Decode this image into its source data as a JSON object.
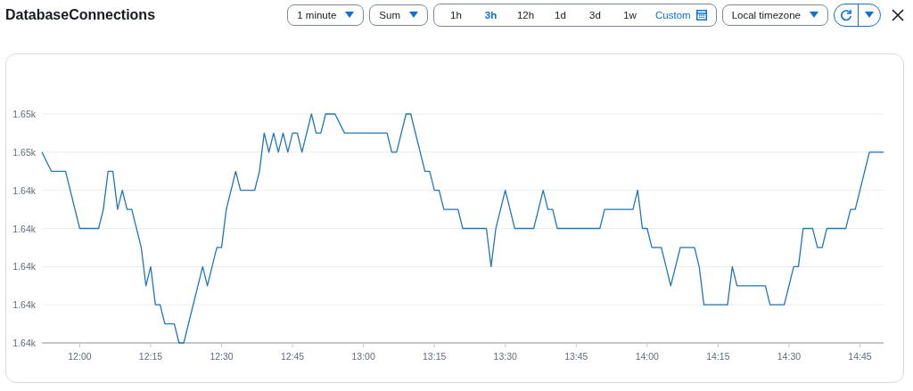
{
  "title": "DatabaseConnections",
  "toolbar": {
    "period": {
      "value": "1 minute"
    },
    "statistic": {
      "value": "Sum"
    },
    "time_range": [
      {
        "label": "1h",
        "selected": false
      },
      {
        "label": "3h",
        "selected": true
      },
      {
        "label": "12h",
        "selected": false
      },
      {
        "label": "1d",
        "selected": false
      },
      {
        "label": "3d",
        "selected": false
      },
      {
        "label": "1w",
        "selected": false
      }
    ],
    "custom": {
      "label": "Custom"
    },
    "timezone": {
      "value": "Local timezone"
    }
  },
  "chart": {
    "chart_data": {
      "type": "line",
      "grid": true,
      "xlim": [
        712,
        890
      ],
      "ylim": [
        1636,
        1648
      ],
      "xticks": [
        {
          "value": 720,
          "label": "12:00"
        },
        {
          "value": 735,
          "label": "12:15"
        },
        {
          "value": 750,
          "label": "12:30"
        },
        {
          "value": 765,
          "label": "12:45"
        },
        {
          "value": 780,
          "label": "13:00"
        },
        {
          "value": 795,
          "label": "13:15"
        },
        {
          "value": 810,
          "label": "13:30"
        },
        {
          "value": 825,
          "label": "13:45"
        },
        {
          "value": 840,
          "label": "14:00"
        },
        {
          "value": 855,
          "label": "14:15"
        },
        {
          "value": 870,
          "label": "14:30"
        },
        {
          "value": 885,
          "label": "14:45"
        }
      ],
      "yticks": [
        {
          "value": 1636,
          "label": "1.64k"
        },
        {
          "value": 1638,
          "label": "1.64k"
        },
        {
          "value": 1640,
          "label": "1.64k"
        },
        {
          "value": 1642,
          "label": "1.64k"
        },
        {
          "value": 1644,
          "label": "1.64k"
        },
        {
          "value": 1646,
          "label": "1.65k"
        },
        {
          "value": 1648,
          "label": "1.65k"
        }
      ],
      "x": [
        712,
        714,
        717,
        720,
        724,
        725,
        726,
        727,
        728,
        729,
        730,
        731,
        733,
        734,
        735,
        736,
        737,
        738,
        740,
        741,
        742,
        746,
        747,
        749,
        750,
        751,
        753,
        754,
        757,
        758,
        759,
        760,
        761,
        762,
        763,
        764,
        765,
        766,
        767,
        769,
        770,
        771,
        772,
        774,
        776,
        785,
        786,
        787,
        789,
        790,
        793,
        794,
        795,
        796,
        797,
        800,
        801,
        806,
        807,
        808,
        810,
        812,
        816,
        818,
        819,
        820,
        821,
        830,
        831,
        837,
        838,
        839,
        840,
        841,
        843,
        845,
        847,
        850,
        851,
        852,
        857,
        858,
        859,
        865,
        866,
        869,
        871,
        872,
        873,
        875,
        876,
        877,
        878,
        882,
        883,
        884,
        887,
        890
      ],
      "series": [
        {
          "color": "#1f77b4",
          "values": [
            1646,
            1645,
            1645,
            1642,
            1642,
            1643,
            1645,
            1645,
            1643,
            1644,
            1643,
            1643,
            1641,
            1639,
            1640,
            1638,
            1638,
            1637,
            1637,
            1636,
            1636,
            1640,
            1639,
            1641,
            1641,
            1643,
            1645,
            1644,
            1644,
            1645,
            1647,
            1646,
            1647,
            1646,
            1647,
            1646,
            1647,
            1647,
            1646,
            1648,
            1647,
            1647,
            1648,
            1648,
            1647,
            1647,
            1646,
            1646,
            1648,
            1648,
            1645,
            1645,
            1644,
            1644,
            1643,
            1643,
            1642,
            1642,
            1640,
            1642,
            1644,
            1642,
            1642,
            1644,
            1643,
            1643,
            1642,
            1642,
            1643,
            1643,
            1644,
            1642,
            1642,
            1641,
            1641,
            1639,
            1641,
            1641,
            1640,
            1638,
            1638,
            1640,
            1639,
            1639,
            1638,
            1638,
            1640,
            1640,
            1642,
            1642,
            1641,
            1641,
            1642,
            1642,
            1643,
            1643,
            1646,
            1646
          ]
        }
      ]
    }
  }
}
